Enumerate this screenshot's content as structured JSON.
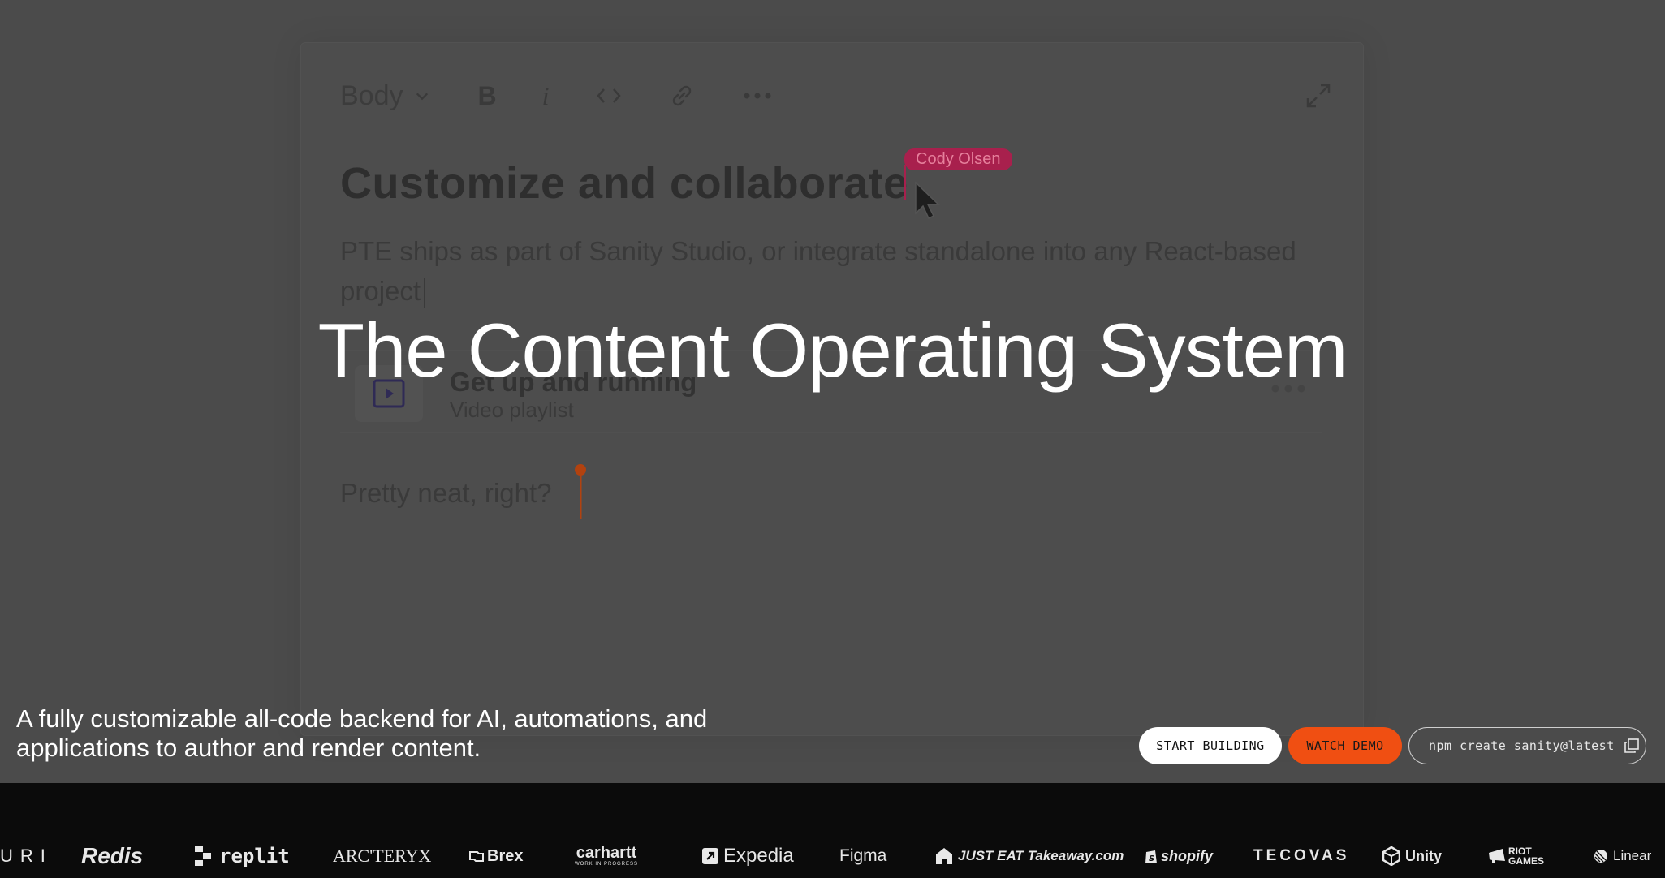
{
  "editor": {
    "style_dropdown": "Body",
    "collaborator_name": "Cody Olsen",
    "title": "Customize and collaborate",
    "paragraph": "PTE ships as part of Sanity Studio, or integrate standalone into any React-based project",
    "embed": {
      "title": "Get up and running",
      "subtitle": "Video playlist"
    },
    "line2": "Pretty neat, right?"
  },
  "hero": {
    "headline": "The Content Operating System",
    "tagline": "A fully customizable all-code backend for AI, automations, and applications to author and render content."
  },
  "actions": {
    "start_label": "START BUILDING",
    "demo_label": "WATCH DEMO",
    "npm_command": "npm create sanity@latest"
  },
  "logos": [
    "URI",
    "Redis",
    "replit",
    "ARC'TERYX",
    "Brex",
    "carhartt",
    "WORK IN PROGRESS",
    "Expedia",
    "Figma",
    "JUST EAT Takeaway.com",
    "shopify",
    "TECOVAS",
    "Unity",
    "RIOT GAMES",
    "Linear"
  ],
  "colors": {
    "accent": "#f04f12",
    "collaborator": "#a8204d",
    "logo_bar": "#0b0b0b"
  }
}
